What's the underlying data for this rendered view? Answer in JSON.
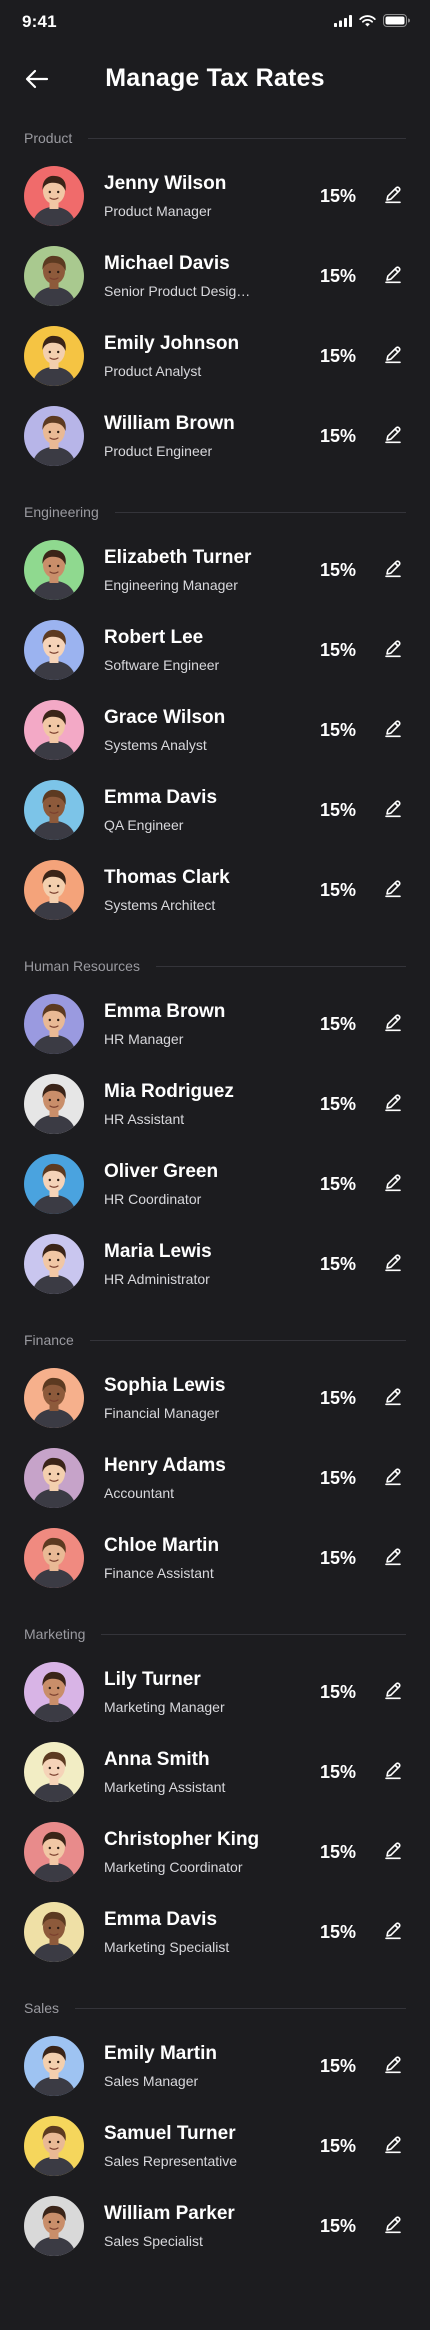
{
  "status": {
    "time": "9:41"
  },
  "header": {
    "title": "Manage Tax Rates"
  },
  "sections": [
    {
      "title": "Product",
      "people": [
        {
          "name": "Jenny Wilson",
          "role": "Product Manager",
          "rate": "15%",
          "avatar_bg": "#f06b6b"
        },
        {
          "name": "Michael Davis",
          "role": "Senior Product Design...",
          "rate": "15%",
          "avatar_bg": "#a9c98f"
        },
        {
          "name": "Emily Johnson",
          "role": "Product Analyst",
          "rate": "15%",
          "avatar_bg": "#f5c443"
        },
        {
          "name": "William Brown",
          "role": "Product Engineer",
          "rate": "15%",
          "avatar_bg": "#b7b5e8"
        }
      ]
    },
    {
      "title": "Engineering",
      "people": [
        {
          "name": "Elizabeth Turner",
          "role": "Engineering Manager",
          "rate": "15%",
          "avatar_bg": "#8fd98f"
        },
        {
          "name": "Robert Lee",
          "role": "Software Engineer",
          "rate": "15%",
          "avatar_bg": "#9bb3f0"
        },
        {
          "name": "Grace Wilson",
          "role": "Systems Analyst",
          "rate": "15%",
          "avatar_bg": "#f3a9c6"
        },
        {
          "name": "Emma Davis",
          "role": "QA Engineer",
          "rate": "15%",
          "avatar_bg": "#7cc4e8"
        },
        {
          "name": "Thomas Clark",
          "role": "Systems Architect",
          "rate": "15%",
          "avatar_bg": "#f4a37a"
        }
      ]
    },
    {
      "title": "Human Resources",
      "people": [
        {
          "name": "Emma Brown",
          "role": "HR Manager",
          "rate": "15%",
          "avatar_bg": "#9a9ae0"
        },
        {
          "name": "Mia Rodriguez",
          "role": "HR Assistant",
          "rate": "15%",
          "avatar_bg": "#e6e6e6"
        },
        {
          "name": "Oliver Green",
          "role": "HR Coordinator",
          "rate": "15%",
          "avatar_bg": "#4aa3df"
        },
        {
          "name": "Maria Lewis",
          "role": "HR Administrator",
          "rate": "15%",
          "avatar_bg": "#c9c6ef"
        }
      ]
    },
    {
      "title": "Finance",
      "people": [
        {
          "name": "Sophia Lewis",
          "role": "Financial Manager",
          "rate": "15%",
          "avatar_bg": "#f6b08c"
        },
        {
          "name": "Henry Adams",
          "role": "Accountant",
          "rate": "15%",
          "avatar_bg": "#c6a3c9"
        },
        {
          "name": "Chloe Martin",
          "role": "Finance Assistant",
          "rate": "15%",
          "avatar_bg": "#f08a80"
        }
      ]
    },
    {
      "title": "Marketing",
      "people": [
        {
          "name": "Lily Turner",
          "role": "Marketing Manager",
          "rate": "15%",
          "avatar_bg": "#d8b4e6"
        },
        {
          "name": "Anna Smith",
          "role": "Marketing Assistant",
          "rate": "15%",
          "avatar_bg": "#f2edc4"
        },
        {
          "name": "Christopher King",
          "role": "Marketing Coordinator",
          "rate": "15%",
          "avatar_bg": "#e88b8b"
        },
        {
          "name": "Emma Davis",
          "role": "Marketing Specialist",
          "rate": "15%",
          "avatar_bg": "#efe0a6"
        }
      ]
    },
    {
      "title": "Sales",
      "people": [
        {
          "name": "Emily Martin",
          "role": "Sales Manager",
          "rate": "15%",
          "avatar_bg": "#9ec3f2"
        },
        {
          "name": "Samuel Turner",
          "role": "Sales Representative",
          "rate": "15%",
          "avatar_bg": "#f5d65c"
        },
        {
          "name": "William Parker",
          "role": "Sales Specialist",
          "rate": "15%",
          "avatar_bg": "#d9d9d9"
        }
      ]
    }
  ],
  "icons": {
    "back": "arrow-left-icon",
    "edit": "pencil-icon",
    "signal": "signal-icon",
    "wifi": "wifi-icon",
    "battery": "battery-icon"
  }
}
